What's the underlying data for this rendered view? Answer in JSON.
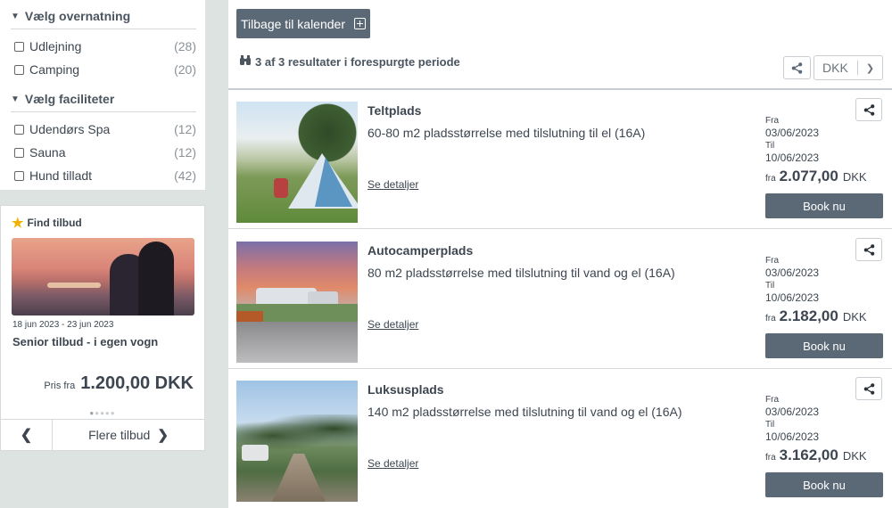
{
  "filters": {
    "groups": [
      {
        "heading": "Vælg overnatning",
        "items": [
          {
            "label": "Udlejning",
            "count": "(28)"
          },
          {
            "label": "Camping",
            "count": "(20)"
          }
        ]
      },
      {
        "heading": "Vælg faciliteter",
        "items": [
          {
            "label": "Udendørs Spa",
            "count": "(12)"
          },
          {
            "label": "Sauna",
            "count": "(12)"
          },
          {
            "label": "Hund tilladt",
            "count": "(42)"
          }
        ]
      }
    ]
  },
  "offer": {
    "heading": "Find tilbud",
    "dates": "18 jun 2023 - 23 jun 2023",
    "title": "Senior tilbud - i egen vogn",
    "price_prefix": "Pris fra",
    "price": "1.200,00 DKK",
    "nav_more": "Flere tilbud"
  },
  "toolbar": {
    "back_label": "Tilbage til kalender",
    "results_text": "3 af 3 resultater i forespurgte periode",
    "currency_value": "DKK"
  },
  "labels": {
    "from": "Fra",
    "to": "Til",
    "price_prefix": "fra",
    "currency": "DKK",
    "details": "Se detaljer",
    "book": "Book nu"
  },
  "results": [
    {
      "title": "Teltplads",
      "description": "60-80 m2 pladsstørrelse med tilslutning til el (16A)",
      "from_date": "03/06/2023",
      "to_date": "10/06/2023",
      "price": "2.077,00"
    },
    {
      "title": "Autocamperplads",
      "description": "80 m2 pladsstørrelse med tilslutning til vand og el (16A)",
      "from_date": "03/06/2023",
      "to_date": "10/06/2023",
      "price": "2.182,00"
    },
    {
      "title": "Luksusplads",
      "description": "140 m2 pladsstørrelse med tilslutning til vand og el (16A)",
      "from_date": "03/06/2023",
      "to_date": "10/06/2023",
      "price": "3.162,00"
    }
  ],
  "colors": {
    "button_bg": "#5b6977",
    "accent_star": "#f0b400",
    "page_bg": "#dde3e1"
  }
}
